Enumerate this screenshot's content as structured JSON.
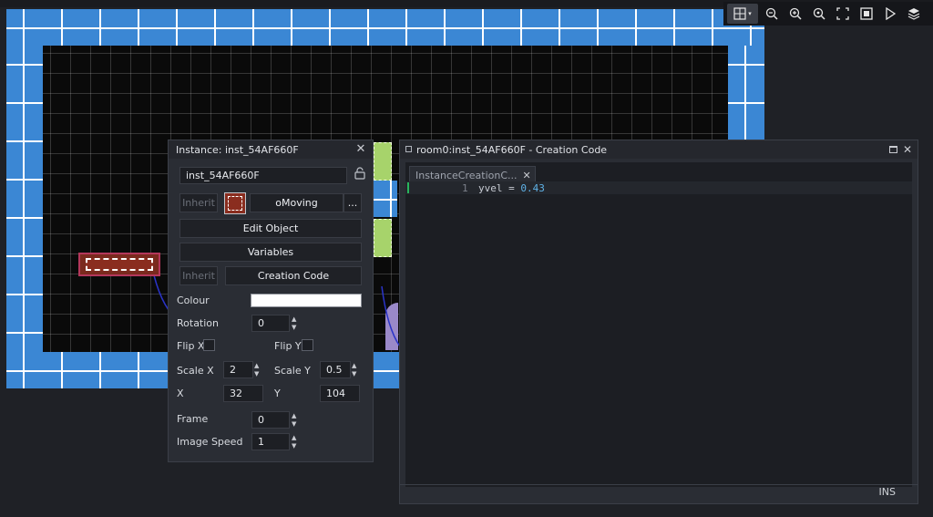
{
  "toolbar": {
    "icons": [
      "grid-icon",
      "zoom-out-icon",
      "zoom-in-icon",
      "zoom-reset-icon",
      "fullscreen-icon",
      "frame-icon",
      "play-icon",
      "layers-icon"
    ]
  },
  "instance_panel": {
    "title": "Instance: inst_54AF660F",
    "name_value": "inst_54AF660F",
    "inherit_label": "Inherit",
    "object_name": "oMoving",
    "more_label": "...",
    "edit_object_label": "Edit Object",
    "variables_label": "Variables",
    "inherit2_label": "Inherit",
    "creation_code_label": "Creation Code",
    "colour_label": "Colour",
    "colour_value": "#ffffff",
    "rotation_label": "Rotation",
    "rotation_value": "0",
    "flipx_label": "Flip X",
    "flipy_label": "Flip Y",
    "scalex_label": "Scale X",
    "scalex_value": "2",
    "scaley_label": "Scale Y",
    "scaley_value": "0.5",
    "x_label": "X",
    "x_value": "32",
    "y_label": "Y",
    "y_value": "104",
    "frame_label": "Frame",
    "frame_value": "0",
    "image_speed_label": "Image Speed",
    "image_speed_value": "1"
  },
  "code_panel": {
    "title": "room0:inst_54AF660F - Creation Code",
    "tab_label": "InstanceCreationC...",
    "line_number": "1",
    "code_var": "yvel",
    "code_op": "=",
    "code_value": "0.43",
    "status": "INS"
  },
  "colors": {
    "wall": "#3b87d4",
    "instance": "#7a2a1e",
    "accent_caret": "#28b55c",
    "code_number": "#5fb2e6"
  }
}
